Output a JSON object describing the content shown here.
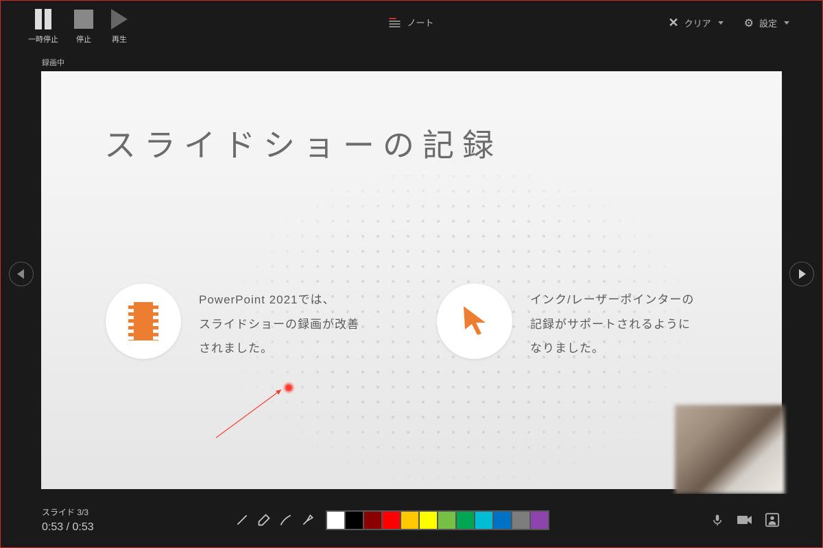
{
  "window_controls": {
    "minimize": "—",
    "maximize": "❐",
    "close": "✕"
  },
  "toolbar": {
    "pause": "一時停止",
    "stop": "停止",
    "play": "再生",
    "notes": "ノート",
    "clear": "クリア",
    "settings": "設定"
  },
  "recording_status": "録画中",
  "slide": {
    "title": "スライドショーの記録",
    "feature1_line1": "PowerPoint 2021では、",
    "feature1_line2": "スライドショーの録画が改善",
    "feature1_line3": "されました。",
    "feature2_line1": "インク/レーザーポインターの",
    "feature2_line2": "記録がサポートされるように",
    "feature2_line3": "なりました。"
  },
  "footer": {
    "slide_counter": "スライド 3/3",
    "elapsed": "0:53",
    "separator": " / ",
    "total": "0:53"
  },
  "swatches": [
    "#ffffff",
    "#000000",
    "#8b0000",
    "#ff0000",
    "#ffc800",
    "#ffff00",
    "#76c043",
    "#00a651",
    "#00bcd4",
    "#0072c6",
    "#7d7d7d",
    "#8e44ad"
  ]
}
